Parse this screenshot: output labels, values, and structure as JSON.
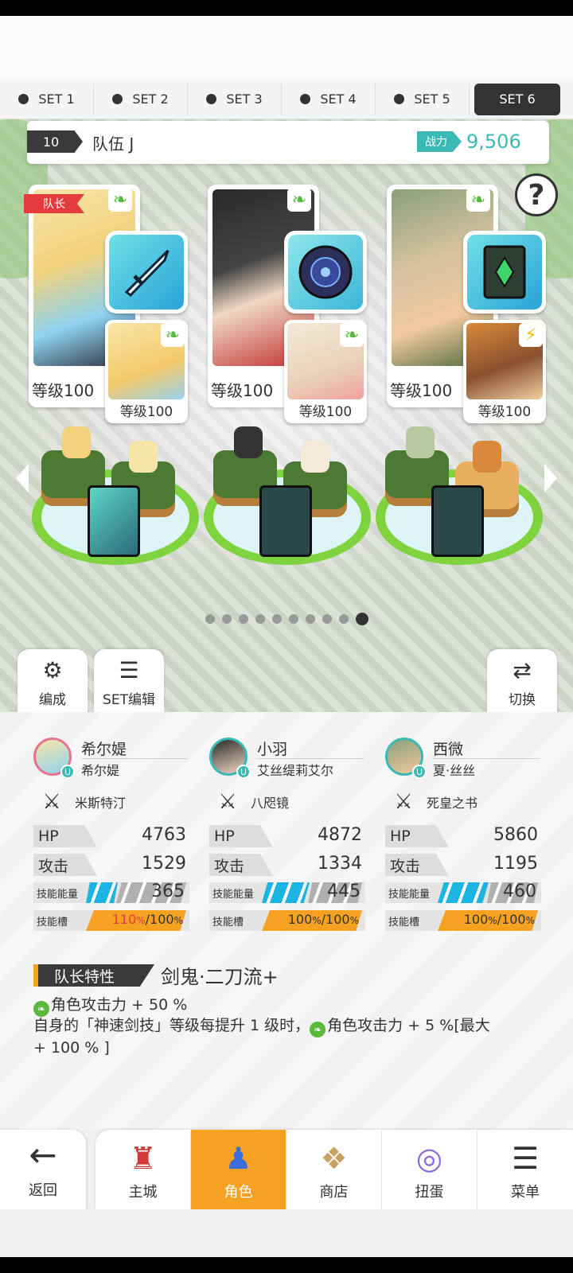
{
  "set_tabs": [
    {
      "label": "SET 1"
    },
    {
      "label": "SET 2"
    },
    {
      "label": "SET 3"
    },
    {
      "label": "SET 4"
    },
    {
      "label": "SET 5"
    },
    {
      "label": "SET 6",
      "active": true
    }
  ],
  "team": {
    "number": "10",
    "name": "队伍 J",
    "power_label": "战力",
    "power_value": "9,506"
  },
  "help_label": "?",
  "heroes": [
    {
      "leader_tag": "队长",
      "level": "等级100",
      "support_level": "等级100",
      "element": "wind",
      "support_element": "wind"
    },
    {
      "level": "等级100",
      "support_level": "等级100",
      "element": "wind",
      "support_element": "wind"
    },
    {
      "level": "等级100",
      "support_level": "等级100",
      "element": "wind",
      "support_element": "lightning"
    }
  ],
  "page_dots": {
    "count": 10,
    "active": 9
  },
  "side_buttons": {
    "formation": "编成",
    "set_edit": "SET编辑",
    "switch": "切换"
  },
  "characters": [
    {
      "name": "希尔媞",
      "sub": "希尔媞",
      "weapon": "米斯特汀",
      "hp_label": "HP",
      "hp": "4763",
      "atk_label": "攻击",
      "atk": "1529",
      "skill_energy_label": "技能能量",
      "skill_energy": "365",
      "skill_slot_label": "技能槽",
      "skill_slot_cur": "110",
      "skill_slot_max": "100",
      "slot_over": true
    },
    {
      "name": "小羽",
      "sub": "艾丝缇莉艾尔",
      "weapon": "八咫镜",
      "hp_label": "HP",
      "hp": "4872",
      "atk_label": "攻击",
      "atk": "1334",
      "skill_energy_label": "技能能量",
      "skill_energy": "445",
      "skill_slot_label": "技能槽",
      "skill_slot_cur": "100",
      "skill_slot_max": "100",
      "slot_over": false
    },
    {
      "name": "西微",
      "sub": "夏·丝丝",
      "weapon": "死皇之书",
      "hp_label": "HP",
      "hp": "5860",
      "atk_label": "攻击",
      "atk": "1195",
      "skill_energy_label": "技能能量",
      "skill_energy": "460",
      "skill_slot_label": "技能槽",
      "skill_slot_cur": "100",
      "skill_slot_max": "100",
      "slot_over": false
    }
  ],
  "leader_trait": {
    "tag": "队长特性",
    "title": "剑鬼·二刀流+",
    "line1": "角色攻击力 + 50 %",
    "line2_a": "自身的「神速剑技」等级每提升 1 级时，",
    "line2_b": "角色攻击力 + 5 %[最大 + 100 % ]"
  },
  "bottom_nav": {
    "back": "返回",
    "items": [
      {
        "label": "主城"
      },
      {
        "label": "角色",
        "active": true
      },
      {
        "label": "商店"
      },
      {
        "label": "扭蛋"
      },
      {
        "label": "菜单"
      }
    ]
  },
  "colors": {
    "accent_orange": "#f5a122",
    "teal": "#3bb9b4",
    "leader_red": "#e43c3c",
    "wind_green": "#5ab83a",
    "skill_blue": "#1cb4e0"
  }
}
